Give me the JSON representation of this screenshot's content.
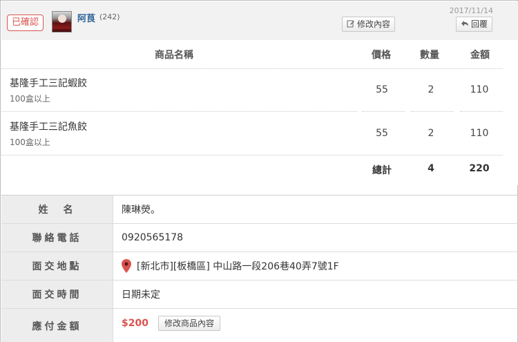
{
  "header": {
    "status": "已確認",
    "user_name": "阿茛",
    "user_count": "(242)",
    "date": "2017/11/14",
    "edit_label": "修改內容",
    "reply_label": "回覆"
  },
  "products": {
    "columns": {
      "name": "商品名稱",
      "price": "價格",
      "qty": "數量",
      "amount": "金額"
    },
    "rows": [
      {
        "name": "基隆手工三記蝦餃",
        "desc": "100盒以上",
        "price": "55",
        "qty": "2",
        "amount": "110"
      },
      {
        "name": "基隆手工三記魚餃",
        "desc": "100盒以上",
        "price": "55",
        "qty": "2",
        "amount": "110"
      }
    ],
    "total": {
      "label": "總計",
      "qty": "4",
      "amount": "220"
    }
  },
  "info": {
    "name": {
      "label": "姓　名",
      "value": "陳琳熒。"
    },
    "phone": {
      "label": "聯絡電話",
      "value": "0920565178"
    },
    "address": {
      "label": "面交地點",
      "value": "[新北市][板橋區] 中山路一段206巷40弄7號1F"
    },
    "time": {
      "label": "面交時間",
      "value": "日期未定"
    },
    "payment": {
      "label": "應付金額",
      "value": "$200",
      "button_label": "修改商品內容"
    }
  },
  "colors": {
    "accent": "#d9534f",
    "link": "#336699",
    "pin": "#d9534f"
  }
}
